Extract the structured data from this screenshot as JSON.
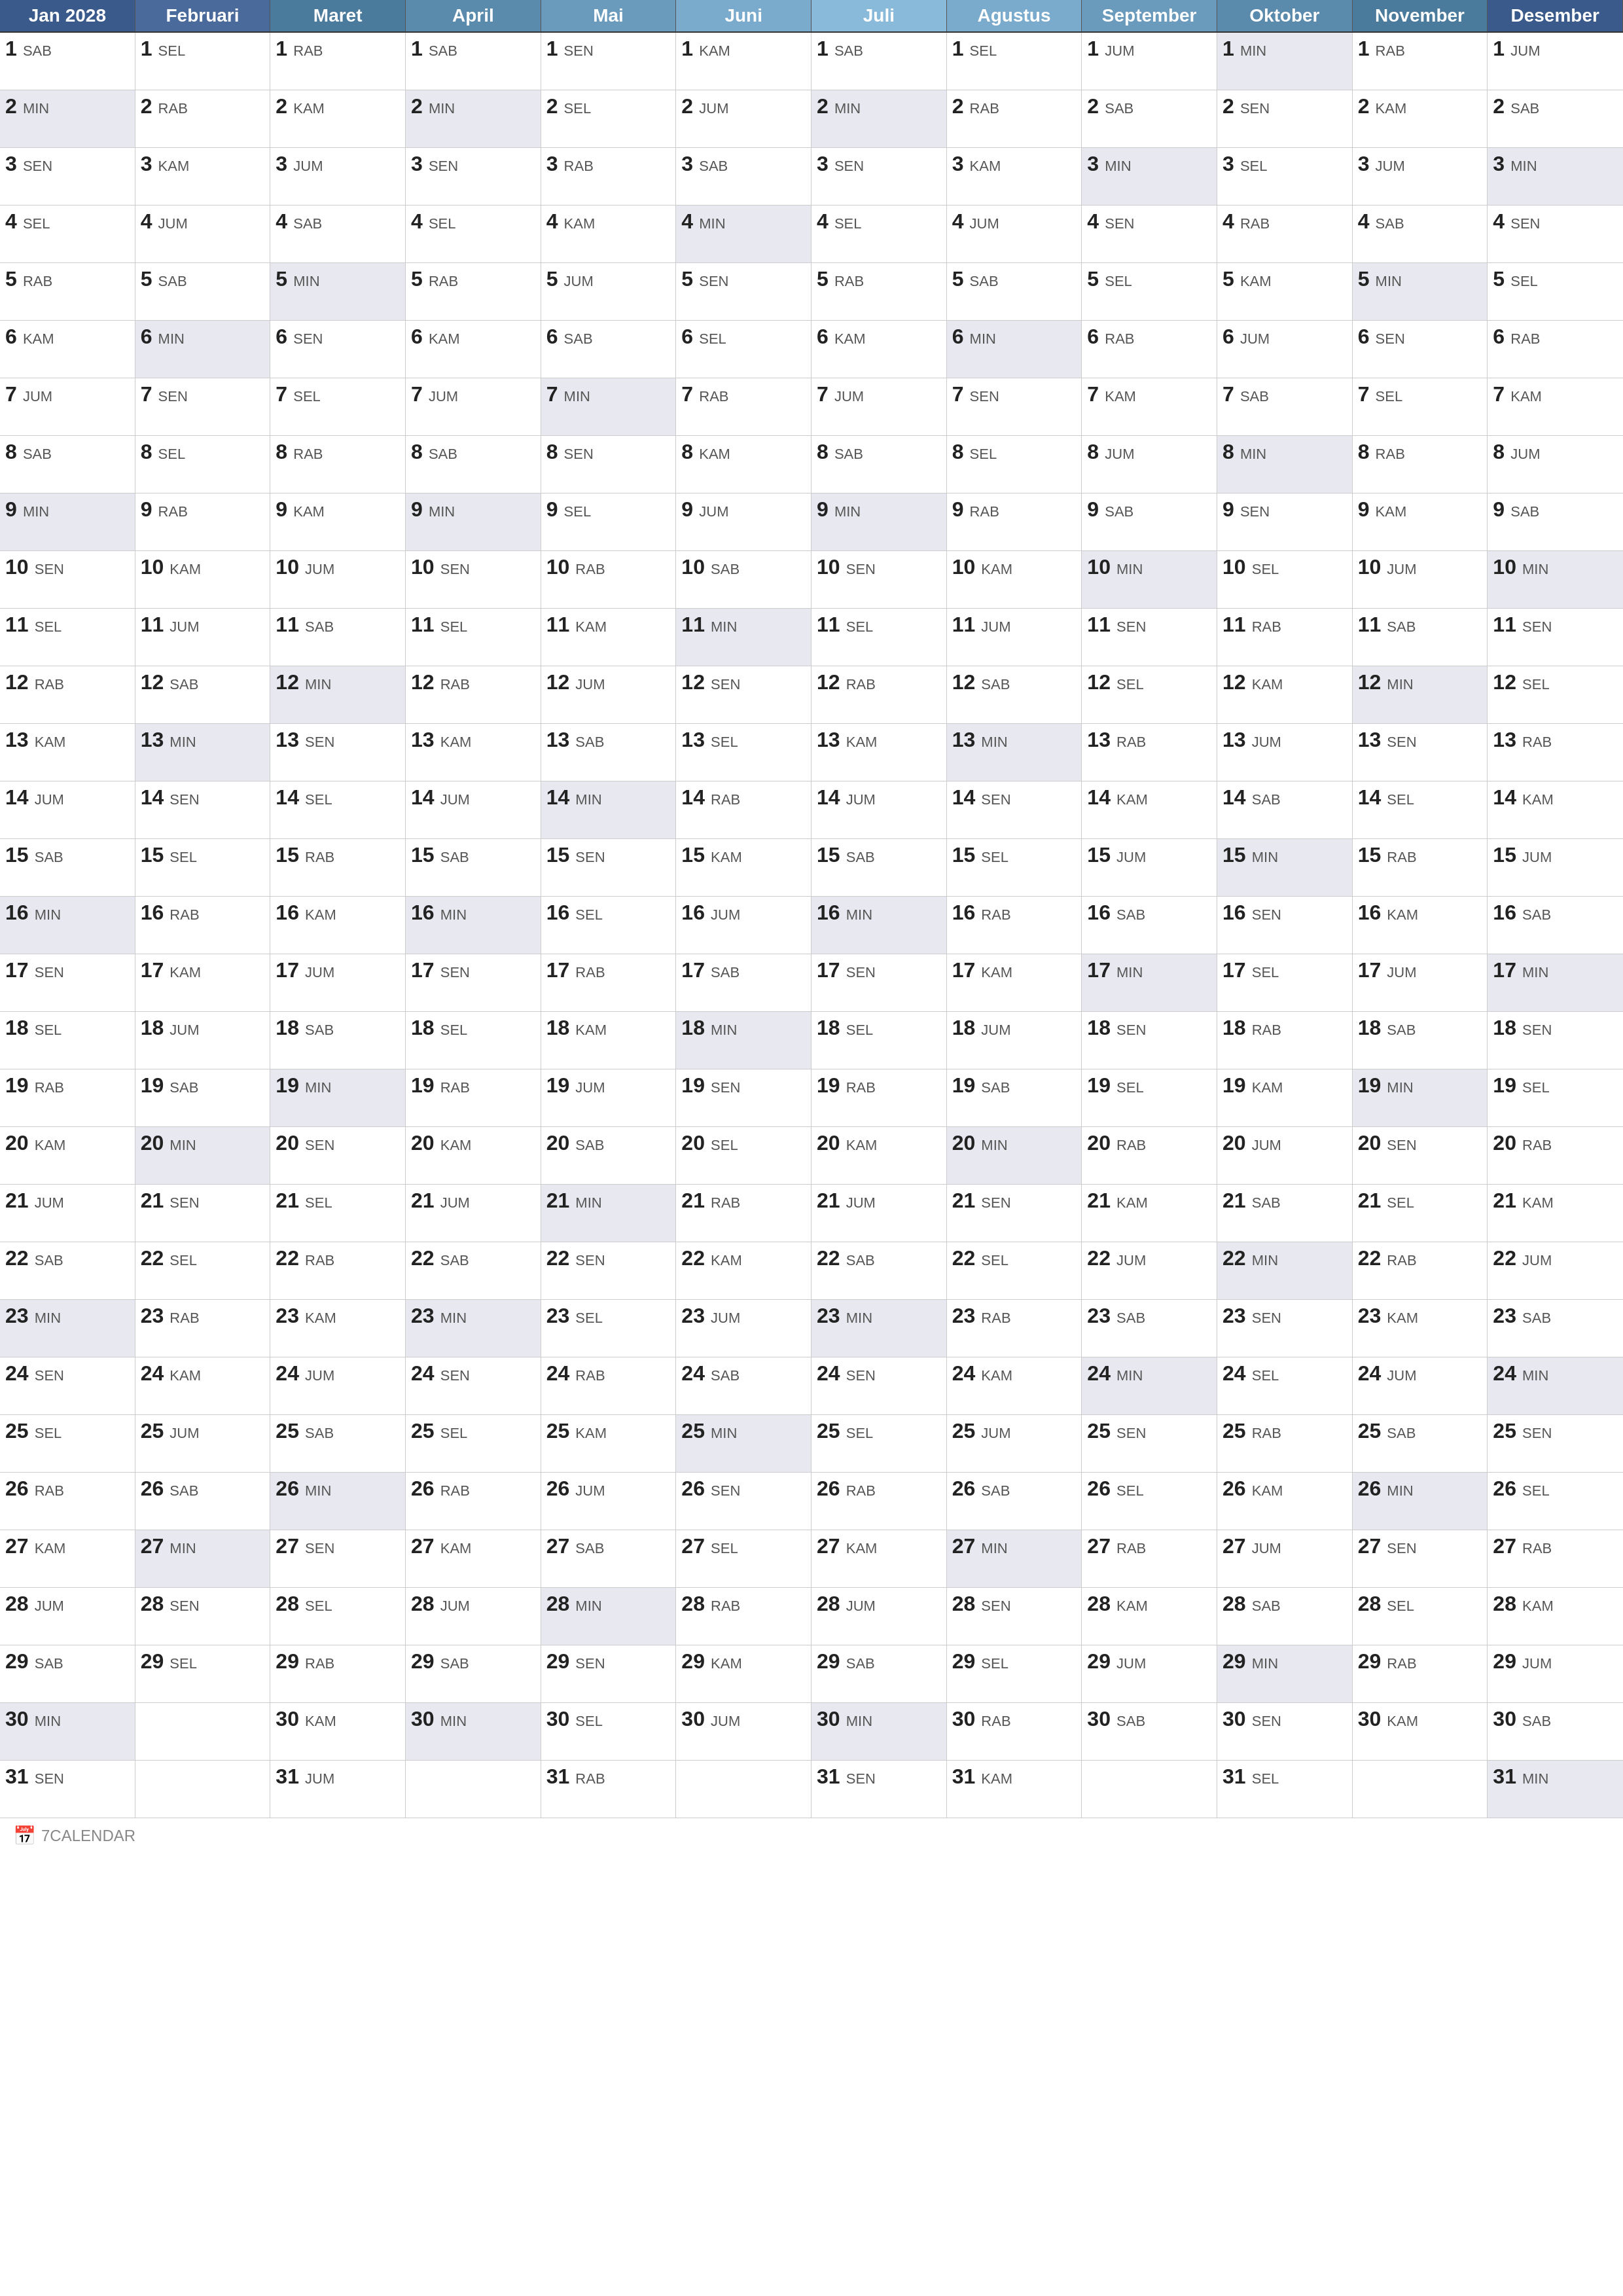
{
  "calendar": {
    "year": "2028",
    "months": [
      {
        "name": "Jan 2028",
        "short": "Jan"
      },
      {
        "name": "Februari",
        "short": "Feb"
      },
      {
        "name": "Maret",
        "short": "Mar"
      },
      {
        "name": "April",
        "short": "Apr"
      },
      {
        "name": "Mai",
        "short": "Mai"
      },
      {
        "name": "Juni",
        "short": "Jun"
      },
      {
        "name": "Juli",
        "short": "Jul"
      },
      {
        "name": "Agustus",
        "short": "Ags"
      },
      {
        "name": "September",
        "short": "Sep"
      },
      {
        "name": "Oktober",
        "short": "Okt"
      },
      {
        "name": "November",
        "short": "Nov"
      },
      {
        "name": "Desember",
        "short": "Des"
      }
    ],
    "days": [
      [
        "SAB",
        "SEL",
        "RAB",
        "SAB",
        "SEN",
        "KAM",
        "SAB",
        "SEL",
        "JUM",
        "MIN",
        "RAB",
        "JUM"
      ],
      [
        "MIN",
        "RAB",
        "KAM",
        "MIN",
        "SEL",
        "JUM",
        "MIN",
        "RAB",
        "SAB",
        "SEN",
        "KAM",
        "SAB"
      ],
      [
        "SEN",
        "KAM",
        "JUM",
        "SEN",
        "RAB",
        "SAB",
        "SEN",
        "KAM",
        "MIN",
        "SEL",
        "JUM",
        "MIN"
      ],
      [
        "SEL",
        "JUM",
        "SAB",
        "SEL",
        "KAM",
        "MIN",
        "SEL",
        "JUM",
        "SEN",
        "RAB",
        "SAB",
        "SEN"
      ],
      [
        "RAB",
        "SAB",
        "MIN",
        "RAB",
        "JUM",
        "SEN",
        "RAB",
        "SAB",
        "SEL",
        "KAM",
        "MIN",
        "SEL"
      ],
      [
        "KAM",
        "MIN",
        "SEN",
        "KAM",
        "SAB",
        "SEL",
        "KAM",
        "MIN",
        "RAB",
        "JUM",
        "SEN",
        "RAB"
      ],
      [
        "JUM",
        "SEN",
        "SEL",
        "JUM",
        "MIN",
        "RAB",
        "JUM",
        "SEN",
        "KAM",
        "SAB",
        "SEL",
        "KAM"
      ],
      [
        "SAB",
        "SEL",
        "RAB",
        "SAB",
        "SEN",
        "KAM",
        "SAB",
        "SEL",
        "JUM",
        "MIN",
        "RAB",
        "JUM"
      ],
      [
        "MIN",
        "RAB",
        "KAM",
        "MIN",
        "SEL",
        "JUM",
        "MIN",
        "RAB",
        "SAB",
        "SEN",
        "KAM",
        "SAB"
      ],
      [
        "SEN",
        "KAM",
        "JUM",
        "SEN",
        "RAB",
        "SAB",
        "SEN",
        "KAM",
        "MIN",
        "SEL",
        "JUM",
        "MIN"
      ],
      [
        "SEL",
        "JUM",
        "SAB",
        "SEL",
        "KAM",
        "MIN",
        "SEL",
        "JUM",
        "SEN",
        "RAB",
        "SAB",
        "SEN"
      ],
      [
        "RAB",
        "SAB",
        "MIN",
        "RAB",
        "JUM",
        "SEN",
        "RAB",
        "SAB",
        "SEL",
        "KAM",
        "MIN",
        "SEL"
      ],
      [
        "KAM",
        "MIN",
        "SEN",
        "KAM",
        "SAB",
        "SEL",
        "KAM",
        "MIN",
        "RAB",
        "JUM",
        "SEN",
        "RAB"
      ],
      [
        "JUM",
        "SEN",
        "SEL",
        "JUM",
        "MIN",
        "RAB",
        "JUM",
        "SEN",
        "KAM",
        "SAB",
        "SEL",
        "KAM"
      ],
      [
        "SAB",
        "SEL",
        "RAB",
        "SAB",
        "SEN",
        "KAM",
        "SAB",
        "SEL",
        "JUM",
        "MIN",
        "RAB",
        "JUM"
      ],
      [
        "MIN",
        "RAB",
        "KAM",
        "MIN",
        "SEL",
        "JUM",
        "MIN",
        "RAB",
        "SAB",
        "SEN",
        "KAM",
        "SAB"
      ],
      [
        "SEN",
        "KAM",
        "JUM",
        "SEN",
        "RAB",
        "SAB",
        "SEN",
        "KAM",
        "MIN",
        "SEL",
        "JUM",
        "MIN"
      ],
      [
        "SEL",
        "JUM",
        "SAB",
        "SEL",
        "KAM",
        "MIN",
        "SEL",
        "JUM",
        "SEN",
        "RAB",
        "SAB",
        "SEN"
      ],
      [
        "RAB",
        "SAB",
        "MIN",
        "RAB",
        "JUM",
        "SEN",
        "RAB",
        "SAB",
        "SEL",
        "KAM",
        "MIN",
        "SEL"
      ],
      [
        "KAM",
        "MIN",
        "SEN",
        "KAM",
        "SAB",
        "SEL",
        "KAM",
        "MIN",
        "RAB",
        "JUM",
        "SEN",
        "RAB"
      ],
      [
        "JUM",
        "SEN",
        "SEL",
        "JUM",
        "MIN",
        "RAB",
        "JUM",
        "SEN",
        "KAM",
        "SAB",
        "SEL",
        "KAM"
      ],
      [
        "SAB",
        "SEL",
        "RAB",
        "SAB",
        "SEN",
        "KAM",
        "SAB",
        "SEL",
        "JUM",
        "MIN",
        "RAB",
        "JUM"
      ],
      [
        "MIN",
        "RAB",
        "KAM",
        "MIN",
        "SEL",
        "JUM",
        "MIN",
        "RAB",
        "SAB",
        "SEN",
        "KAM",
        "SAB"
      ],
      [
        "SEN",
        "KAM",
        "JUM",
        "SEN",
        "RAB",
        "SAB",
        "SEN",
        "KAM",
        "MIN",
        "SEL",
        "JUM",
        "MIN"
      ],
      [
        "SEL",
        "JUM",
        "SAB",
        "SEL",
        "KAM",
        "MIN",
        "SEL",
        "JUM",
        "SEN",
        "RAB",
        "SAB",
        "SEN"
      ],
      [
        "RAB",
        "SAB",
        "MIN",
        "RAB",
        "JUM",
        "SEN",
        "RAB",
        "SAB",
        "SEL",
        "KAM",
        "MIN",
        "SEL"
      ],
      [
        "KAM",
        "MIN",
        "SEN",
        "KAM",
        "SAB",
        "SEL",
        "KAM",
        "MIN",
        "RAB",
        "JUM",
        "SEN",
        "RAB"
      ],
      [
        "JUM",
        "SEN",
        "SEL",
        "JUM",
        "MIN",
        "RAB",
        "JUM",
        "SEN",
        "KAM",
        "SAB",
        "SEL",
        "KAM"
      ],
      [
        "SAB",
        "SEL",
        "RAB",
        "SAB",
        "SEN",
        "KAM",
        "SAB",
        "SEL",
        "JUM",
        "MIN",
        "RAB",
        "JUM"
      ],
      [
        "MIN",
        null,
        "KAM",
        "MIN",
        "SEL",
        "JUM",
        "MIN",
        "RAB",
        "SAB",
        "SEN",
        "KAM",
        "SAB"
      ],
      [
        "SEN",
        null,
        "JUM",
        null,
        "RAB",
        null,
        "SEN",
        "KAM",
        null,
        "SEL",
        null,
        "MIN"
      ]
    ],
    "month_days": [
      31,
      29,
      31,
      30,
      31,
      30,
      31,
      31,
      30,
      31,
      30,
      31
    ],
    "footer": "7CALENDAR"
  }
}
